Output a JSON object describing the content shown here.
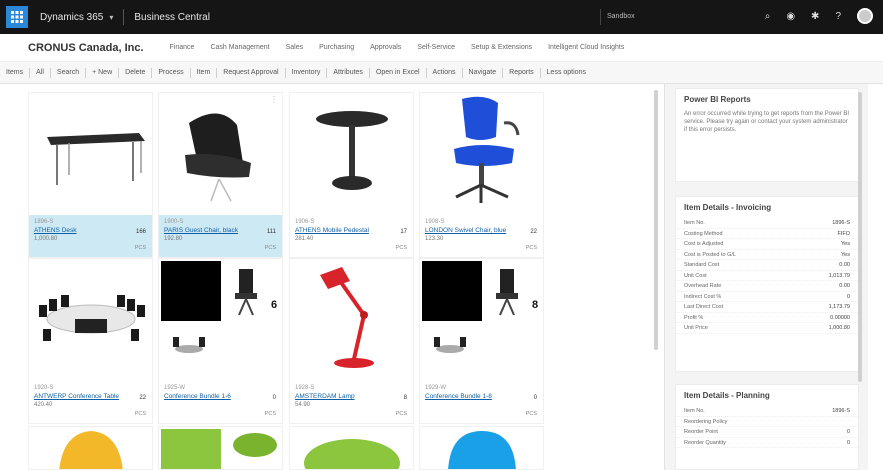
{
  "topbar": {
    "app_name": "Dynamics 365",
    "module": "Business Central",
    "env": "Sandbox",
    "search_label": "Search"
  },
  "nav": {
    "company": "CRONUS Canada, Inc.",
    "links": [
      "Finance",
      "Cash Management",
      "Sales",
      "Purchasing",
      "Approvals",
      "Self-Service",
      "Setup & Extensions",
      "Intelligent Cloud Insights"
    ]
  },
  "actions": [
    "Items",
    "All",
    "Search",
    "+ New",
    "Delete",
    "Process",
    "Item",
    "Request Approval",
    "Inventory",
    "Attributes",
    "Open in Excel",
    "Actions",
    "Navigate",
    "Reports",
    "Less options"
  ],
  "tiles": [
    {
      "no": "1896-S",
      "desc": "ATHENS Desk",
      "inv": "166",
      "price": "1,000.80",
      "uom": "PCS",
      "selected": true
    },
    {
      "no": "1900-S",
      "desc": "PARIS Guest Chair, black",
      "inv": "111",
      "price": "192.80",
      "uom": "PCS",
      "selected": true
    },
    {
      "no": "1906-S",
      "desc": "ATHENS Mobile Pedestal",
      "inv": "17",
      "price": "281.40",
      "uom": "PCS",
      "selected": false
    },
    {
      "no": "1908-S",
      "desc": "LONDON Swivel Chair, blue",
      "inv": "22",
      "price": "123.30",
      "uom": "PCS",
      "selected": false
    },
    {
      "no": "1920-S",
      "desc": "ANTWERP Conference Table",
      "inv": "22",
      "price": "420.40",
      "uom": "PCS",
      "selected": false
    },
    {
      "no": "1925-W",
      "desc": "Conference Bundle 1-6",
      "inv": "0",
      "price": "",
      "uom": "PCS",
      "selected": false
    },
    {
      "no": "1928-S",
      "desc": "AMSTERDAM Lamp",
      "inv": "8",
      "price": "54.90",
      "uom": "PCS",
      "selected": false
    },
    {
      "no": "1929-W",
      "desc": "Conference Bundle 1-8",
      "inv": "0",
      "price": "",
      "uom": "PCS",
      "selected": false
    }
  ],
  "bundle_badges": [
    "6",
    "8"
  ],
  "factbox": {
    "power_bi_title": "Power BI Reports",
    "power_bi_text": "An error occurred while trying to get reports from the Power BI service. Please try again or contact your system administrator if this error persists.",
    "invoicing_title": "Item Details - Invoicing",
    "invoicing_rows": [
      {
        "label": "Item No.",
        "value": "1896-S"
      },
      {
        "label": "Costing Method",
        "value": "FIFO"
      },
      {
        "label": "Cost is Adjusted",
        "value": "Yes"
      },
      {
        "label": "Cost is Posted to G/L",
        "value": "Yes"
      },
      {
        "label": "Standard Cost",
        "value": "0.00"
      },
      {
        "label": "Unit Cost",
        "value": "1,013.79"
      },
      {
        "label": "Overhead Rate",
        "value": "0.00"
      },
      {
        "label": "Indirect Cost %",
        "value": "0"
      },
      {
        "label": "Last Direct Cost",
        "value": "1,173.79"
      },
      {
        "label": "Profit %",
        "value": "0.00000"
      },
      {
        "label": "Unit Price",
        "value": "1,000.80"
      }
    ],
    "planning_title": "Item Details - Planning",
    "planning_rows": [
      {
        "label": "Item No.",
        "value": "1896-S"
      },
      {
        "label": "Reordering Policy",
        "value": ""
      },
      {
        "label": "Reorder Point",
        "value": "0"
      },
      {
        "label": "Reorder Quantity",
        "value": "0"
      }
    ]
  }
}
